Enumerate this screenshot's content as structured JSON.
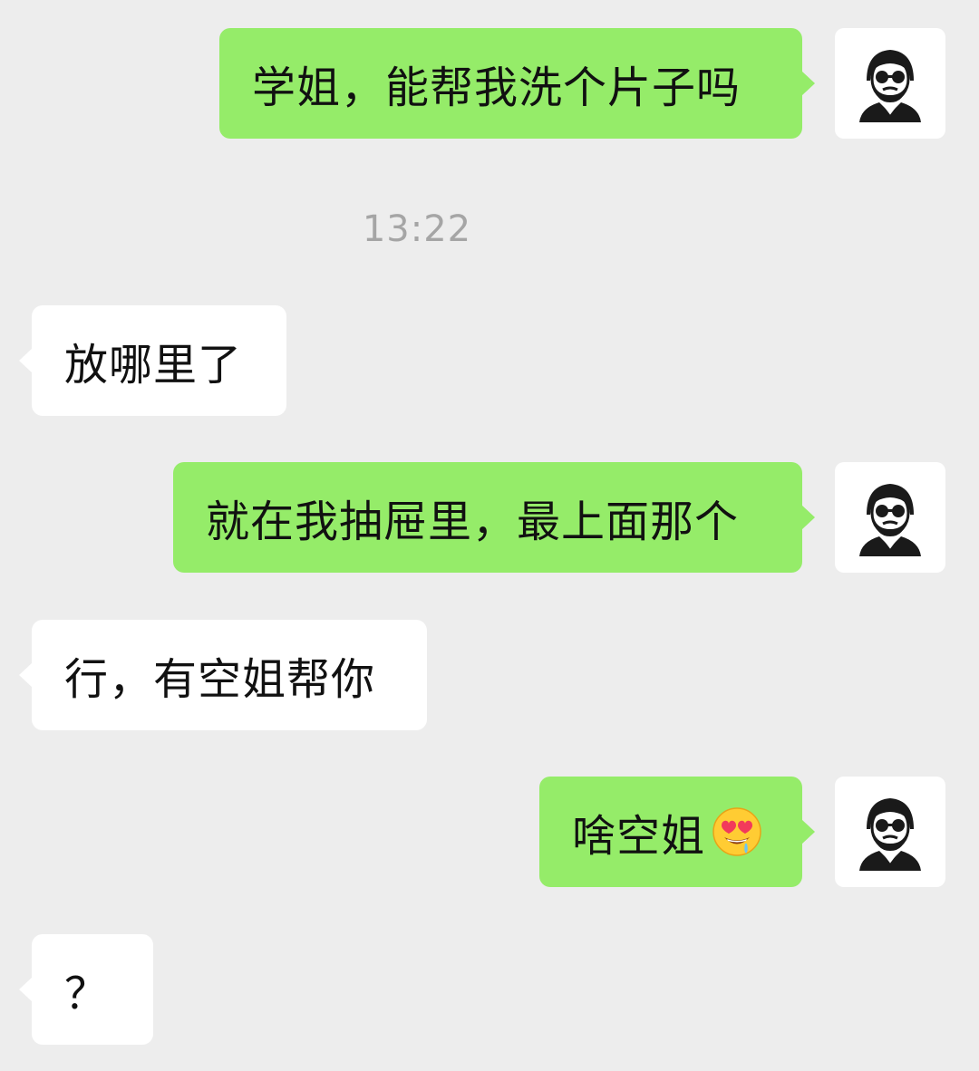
{
  "chat": {
    "timestamp": "13:22",
    "messages": [
      {
        "from": "me",
        "text": "学姐，能帮我洗个片子吗"
      },
      {
        "from": "them",
        "text": "放哪里了"
      },
      {
        "from": "me",
        "text": "就在我抽屉里，最上面那个"
      },
      {
        "from": "them",
        "text": "行，有空姐帮你"
      },
      {
        "from": "me",
        "text": "啥空姐",
        "emoji": "heart-eyes-drooling-emoji"
      },
      {
        "from": "them",
        "text": "？"
      }
    ]
  },
  "avatar": {
    "icon": "man-sunglasses-beard-avatar-icon"
  },
  "colors": {
    "background": "#ededed",
    "outgoing_bubble": "#95ec69",
    "incoming_bubble": "#ffffff",
    "timestamp_text": "#a5a5a5"
  }
}
